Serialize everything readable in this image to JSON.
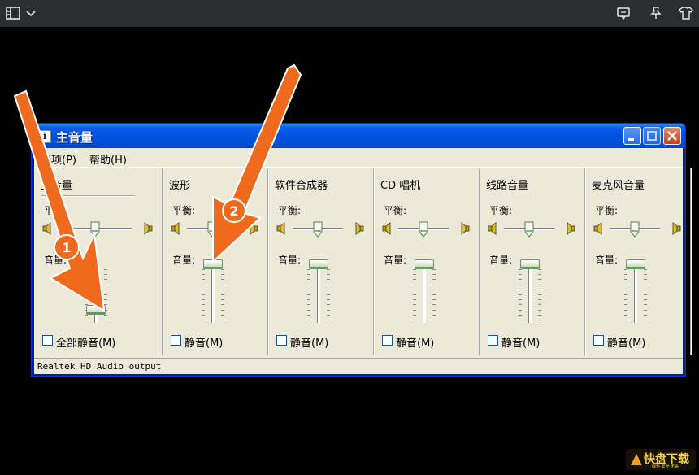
{
  "window": {
    "title": "主音量",
    "app_icon_glyph": "i",
    "menu": [
      "选项(P)",
      "帮助(H)"
    ],
    "status": "Realtek HD Audio output"
  },
  "channels": [
    {
      "name": "主音量",
      "balance_label": "平衡:",
      "volume_label": "音量:",
      "mute_label": "全部静音(M)",
      "muted": false,
      "balance": 0.5,
      "volume": 0.15
    },
    {
      "name": "波形",
      "balance_label": "平衡:",
      "volume_label": "音量:",
      "mute_label": "静音(M)",
      "muted": false,
      "balance": 0.5,
      "volume": 1.0
    },
    {
      "name": "软件合成器",
      "balance_label": "平衡:",
      "volume_label": "音量:",
      "mute_label": "静音(M)",
      "muted": false,
      "balance": 0.5,
      "volume": 1.0
    },
    {
      "name": "CD 唱机",
      "balance_label": "平衡:",
      "volume_label": "音量:",
      "mute_label": "静音(M)",
      "muted": false,
      "balance": 0.5,
      "volume": 1.0
    },
    {
      "name": "线路音量",
      "balance_label": "平衡:",
      "volume_label": "音量:",
      "mute_label": "静音(M)",
      "muted": false,
      "balance": 0.5,
      "volume": 1.0
    },
    {
      "name": "麦克风音量",
      "balance_label": "平衡:",
      "volume_label": "音量:",
      "mute_label": "静音(M)",
      "muted": false,
      "balance": 0.5,
      "volume": 1.0
    }
  ],
  "annotations": [
    {
      "number": "1",
      "color": "#f06a1e"
    },
    {
      "number": "2",
      "color": "#f06a1e"
    }
  ],
  "watermark": {
    "text": "快盘下载",
    "sub": "绿色·安全·无毒"
  },
  "colors": {
    "title_bar": "#0053e1",
    "client_bg": "#ece9d8",
    "arrow": "#f06a1e"
  }
}
